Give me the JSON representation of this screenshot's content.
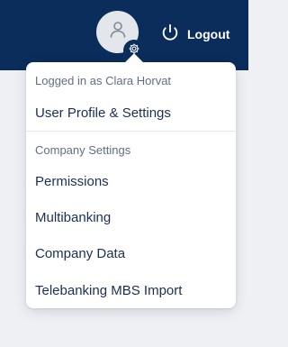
{
  "header": {
    "avatar_icon": "user-icon",
    "badge_icon": "gear-icon",
    "logout_icon": "power-icon",
    "logout_label": "Logout",
    "background_color": "#0b2d5b"
  },
  "user_menu": {
    "logged_in_label": "Logged in as Clara Horvat",
    "profile_item": "User Profile & Settings",
    "company_section_label": "Company Settings",
    "company_items": [
      "Permissions",
      "Multibanking",
      "Company Data",
      "Telebanking MBS Import"
    ]
  }
}
